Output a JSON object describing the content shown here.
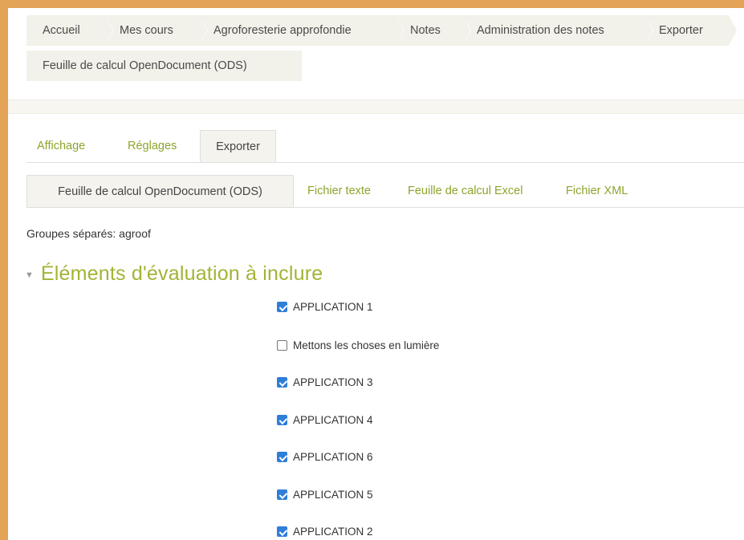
{
  "breadcrumb": {
    "items": [
      "Accueil",
      "Mes cours",
      "Agroforesterie approfondie",
      "Notes",
      "Administration des notes",
      "Exporter"
    ],
    "current": "Feuille de calcul OpenDocument (ODS)"
  },
  "tabs": {
    "primary": [
      "Affichage",
      "Réglages",
      "Exporter"
    ],
    "secondary": [
      "Feuille de calcul OpenDocument (ODS)",
      "Fichier texte",
      "Feuille de calcul Excel",
      "Fichier XML"
    ]
  },
  "groups_label": "Groupes séparés: agroof",
  "section": {
    "title": "Éléments d'évaluation à inclure",
    "items": [
      {
        "label": "APPLICATION 1",
        "checked": true
      },
      {
        "label": "Mettons les choses en lumière",
        "checked": false
      },
      {
        "label": "APPLICATION 3",
        "checked": true
      },
      {
        "label": "APPLICATION 4",
        "checked": true
      },
      {
        "label": "APPLICATION 6",
        "checked": true
      },
      {
        "label": "APPLICATION 5",
        "checked": true
      },
      {
        "label": "APPLICATION 2",
        "checked": true
      }
    ]
  },
  "colors": {
    "frame": "#e3a457",
    "link_green": "#8ca52c",
    "title_green": "#a4b335",
    "checkbox_blue": "#2f7ed8"
  },
  "icons": {
    "section_toggle": "triangle-down-icon",
    "checkbox": "checkbox-icon"
  }
}
